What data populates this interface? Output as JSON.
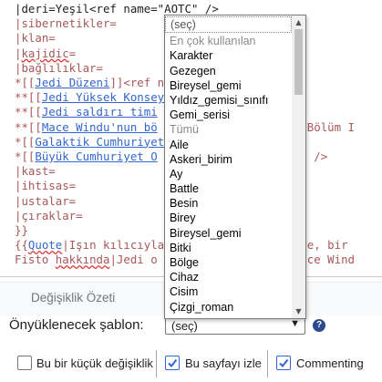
{
  "editor": {
    "lines": [
      [
        {
          "t": "|deri=Yeşil<ref name=\"AOTC\" />",
          "c": ""
        }
      ],
      [
        {
          "t": "|sibernetikler=",
          "c": "m"
        }
      ],
      [
        {
          "t": "|klan=",
          "c": "m"
        }
      ],
      [
        {
          "t": "|",
          "c": "m"
        },
        {
          "t": "kajidic",
          "c": "m sq"
        },
        {
          "t": "=",
          "c": "m"
        }
      ],
      [
        {
          "t": "|bağlılıklar=",
          "c": "m"
        }
      ],
      [
        {
          "t": "*[[",
          "c": "m"
        },
        {
          "t": "Jedi Düzeni",
          "c": "l"
        },
        {
          "t": "]]<ref n",
          "c": "m"
        }
      ],
      [
        {
          "t": "**[[",
          "c": "m"
        },
        {
          "t": "Jedi Yüksek Konsey",
          "c": "l"
        },
        {
          "t": "                  />",
          "c": "m"
        }
      ],
      [
        {
          "t": "**[[",
          "c": "m"
        },
        {
          "t": "Jedi saldırı timi",
          "c": "l"
        }
      ],
      [
        {
          "t": "**[[",
          "c": "m"
        },
        {
          "t": "Mace Windu'nun bö",
          "c": "l"
        },
        {
          "t": "                  du, Bölüm I",
          "c": "m"
        }
      ],
      [
        {
          "t": "*[[",
          "c": "m"
        },
        {
          "t": "Galaktik Cumhuriyet",
          "c": "l"
        },
        {
          "t": "                 >",
          "c": "m"
        }
      ],
      [
        {
          "t": "*[[",
          "c": "m"
        },
        {
          "t": "Büyük Cumhuriyet O",
          "c": "l"
        },
        {
          "t": "                  OTC\" />",
          "c": "m"
        }
      ],
      [
        {
          "t": "|kast=",
          "c": "m"
        }
      ],
      [
        {
          "t": "|ihtisas=",
          "c": "m"
        }
      ],
      [
        {
          "t": "|ustalar=",
          "c": "m"
        }
      ],
      [
        {
          "t": "|çıraklar=",
          "c": "m"
        }
      ],
      [
        {
          "t": "}}",
          "c": "m"
        }
      ],
      [
        {
          "t": "{{",
          "c": "m"
        },
        {
          "t": "Quote",
          "c": "l sq"
        },
        {
          "t": "|Işın kılıcıyla",
          "c": "m"
        },
        {
          "t": "                 iz ve, bir",
          "c": "m"
        }
      ],
      [
        {
          "t": "Fisto ",
          "c": "m"
        },
        {
          "t": "hakkında",
          "c": "m sq"
        },
        {
          "t": "|Jedi o",
          "c": "m"
        },
        {
          "t": "                  ; Mace Wind",
          "c": "m"
        }
      ]
    ]
  },
  "summary": {
    "label": "Değişiklik Özeti"
  },
  "template": {
    "label": "Önyüklenecek şablon:",
    "selected": "(seç)"
  },
  "dropdown": {
    "options": [
      {
        "label": "(seç)",
        "kind": "selected"
      },
      {
        "label": "En çok kullanılan",
        "kind": "header"
      },
      {
        "label": "Karakter",
        "kind": "item"
      },
      {
        "label": "Gezegen",
        "kind": "item"
      },
      {
        "label": "Bireysel_gemi",
        "kind": "item"
      },
      {
        "label": "Yıldız_gemisi_sınıfı",
        "kind": "item"
      },
      {
        "label": "Gemi_serisi",
        "kind": "item"
      },
      {
        "label": "Tümü",
        "kind": "header"
      },
      {
        "label": "Aile",
        "kind": "item"
      },
      {
        "label": "Askeri_birim",
        "kind": "item"
      },
      {
        "label": "Ay",
        "kind": "item"
      },
      {
        "label": "Battle",
        "kind": "item"
      },
      {
        "label": "Besin",
        "kind": "item"
      },
      {
        "label": "Birey",
        "kind": "item"
      },
      {
        "label": "Bireysel_gemi",
        "kind": "item"
      },
      {
        "label": "Bitki",
        "kind": "item"
      },
      {
        "label": "Bölge",
        "kind": "item"
      },
      {
        "label": "Cihaz",
        "kind": "item"
      },
      {
        "label": "Cisim",
        "kind": "item"
      },
      {
        "label": "Çizgi_roman",
        "kind": "item"
      }
    ]
  },
  "checkboxes": {
    "minor": {
      "label": "Bu bir küçük değişiklik",
      "checked": false
    },
    "watch": {
      "label": "Bu sayfayı izle",
      "checked": true
    },
    "commenting": {
      "label": "Commenting",
      "checked": true
    }
  },
  "icons": {
    "help": "help-icon",
    "chevron": "chevron-down-icon",
    "check": "checkmark-icon"
  },
  "colors": {
    "link": "#3366cc",
    "markup": "#a55858",
    "accent": "#36c",
    "help": "#2a4b8d"
  }
}
